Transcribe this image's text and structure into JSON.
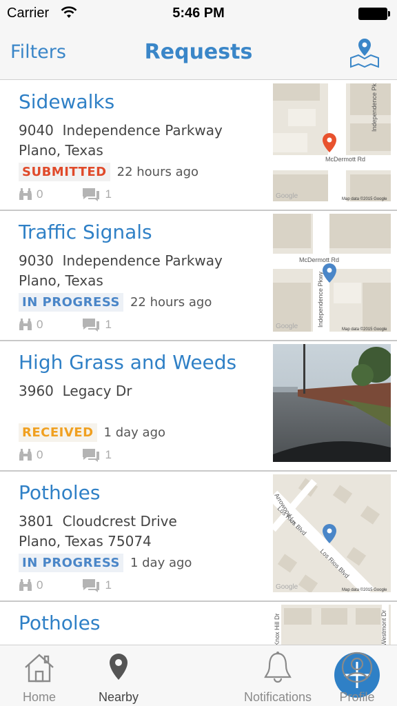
{
  "status_bar": {
    "carrier": "Carrier",
    "time": "5:46 PM"
  },
  "nav": {
    "left": "Filters",
    "title": "Requests",
    "right_icon": "map-pin-icon"
  },
  "requests": [
    {
      "title": "Sidewalks",
      "address_line1": "9040  Independence Parkway",
      "address_line2": "Plano, Texas",
      "status": "SUBMITTED",
      "status_color": "#e04a2a",
      "time_ago": "22 hours ago",
      "followers": "0",
      "comments": "1",
      "thumb": "map"
    },
    {
      "title": "Traffic Signals",
      "address_line1": "9030  Independence Parkway",
      "address_line2": "Plano, Texas",
      "status": "IN PROGRESS",
      "status_color": "#4a86c8",
      "time_ago": "22 hours ago",
      "followers": "0",
      "comments": "1",
      "thumb": "map"
    },
    {
      "title": "High Grass and Weeds",
      "address_line1": "3960  Legacy Dr",
      "address_line2": "",
      "status": "RECEIVED",
      "status_color": "#f0a020",
      "time_ago": "1 day ago",
      "followers": "0",
      "comments": "1",
      "thumb": "photo"
    },
    {
      "title": "Potholes",
      "address_line1": "3801  Cloudcrest Drive",
      "address_line2": "Plano, Texas 75074",
      "status": "IN PROGRESS",
      "status_color": "#4a86c8",
      "time_ago": "1 day ago",
      "followers": "0",
      "comments": "1",
      "thumb": "map"
    },
    {
      "title": "Potholes",
      "thumb": "map"
    }
  ],
  "maps": {
    "row1": {
      "streets": [
        "Independence Pkwy",
        "McDermott Rd"
      ],
      "credit": "Map data ©2015 Google",
      "logo": "Google",
      "pin_color": "#e8522e"
    },
    "row2": {
      "streets": [
        "McDermott Rd",
        "Independence Pkwy"
      ],
      "credit": "Map data ©2015 Google",
      "logo": "Google",
      "pin_color": "#4a86c8"
    },
    "row4": {
      "streets": [
        "Arrowood Ln",
        "Los Rios Blvd",
        "Los Rios Blvd"
      ],
      "credit": "Map data ©2015 Google",
      "logo": "Google",
      "pin_color": "#4a86c8"
    },
    "row5": {
      "streets": [
        "Knox Hill Dr",
        "Westmont Dr"
      ]
    }
  },
  "tabs": [
    {
      "label": "Home",
      "icon": "home-icon"
    },
    {
      "label": "Nearby",
      "icon": "location-pin-icon",
      "active": true
    },
    {
      "label": "",
      "icon": "plus-icon"
    },
    {
      "label": "Notifications",
      "icon": "bell-icon"
    },
    {
      "label": "Profile",
      "icon": "user-icon"
    }
  ]
}
